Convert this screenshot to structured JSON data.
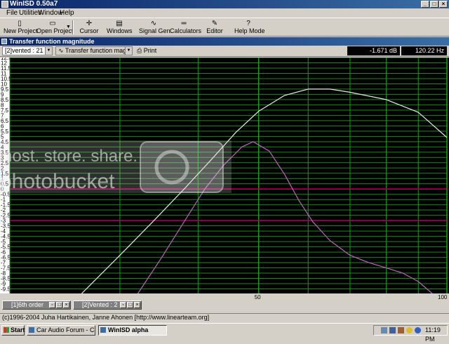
{
  "app": {
    "title": "WinISD 0.50a7",
    "window_buttons": [
      "_",
      "□",
      "×"
    ]
  },
  "menu": [
    "File",
    "Utilities",
    "Window",
    "Help"
  ],
  "toolbar": [
    {
      "label": "New Project",
      "icon": "new-project-icon"
    },
    {
      "label": "Open Project",
      "icon": "open-project-icon"
    },
    {
      "label": "Cursor",
      "icon": "cursor-icon"
    },
    {
      "label": "Windows",
      "icon": "windows-icon"
    },
    {
      "label": "Signal Gen.",
      "icon": "signal-generator-icon"
    },
    {
      "label": "Calculators",
      "icon": "calculators-icon"
    },
    {
      "label": "Editor",
      "icon": "editor-icon"
    },
    {
      "label": "Help Mode",
      "icon": "help-mode-icon"
    }
  ],
  "doc_window": {
    "title": "Transfer function magnitude",
    "project_select": "[2]vented : 21",
    "graph_select": "Transfer function magnitude",
    "print_label": "Print",
    "readout_db": "-1.671 dB",
    "readout_hz": "120.22 Hz"
  },
  "chart_data": {
    "type": "line",
    "title": "",
    "xlabel": "",
    "ylabel": "",
    "x_scale": "log",
    "xlim": [
      20,
      100
    ],
    "ylim": [
      -10,
      12.5
    ],
    "x_tick_labels": [
      "50",
      "100"
    ],
    "y_tick_labels": [
      "12.5",
      "12",
      "11.5",
      "11",
      "10.5",
      "10",
      "9.5",
      "9",
      "8.5",
      "8",
      "7.5",
      "7",
      "6.5",
      "6",
      "5.5",
      "5",
      "4.5",
      "4",
      "3.5",
      "3",
      "2.5",
      "2",
      "1.5",
      "1",
      "0.5",
      "0",
      "-0.5",
      "-1",
      "-1.5",
      "-2",
      "-2.5",
      "-3",
      "-3.5",
      "-4",
      "-4.5",
      "-5",
      "-5.5",
      "-6",
      "-6.5",
      "-7",
      "-7.5",
      "-8",
      "-8.5",
      "-9",
      "-9.5"
    ],
    "grid": true,
    "colors": {
      "background": "#000000",
      "grid_h": "#1e8a1e",
      "grid_v": "#14a014",
      "curve1": "#e8e8e8",
      "curve2": "#c060c0",
      "ref_line": "#b0005a"
    },
    "reference_lines_db": [
      0,
      -3
    ],
    "series": [
      {
        "x": [
          26,
          30,
          34,
          38,
          42,
          46,
          50,
          55,
          60,
          65,
          70,
          80,
          90,
          100
        ],
        "y": [
          -10,
          -6.3,
          -3.0,
          0,
          2.8,
          5.4,
          7.4,
          8.9,
          9.5,
          9.5,
          9.2,
          8.5,
          7.3,
          4.9
        ]
      },
      {
        "x": [
          32,
          35,
          38,
          41,
          44,
          47,
          49,
          52,
          55,
          58,
          61,
          65,
          70,
          75,
          80,
          85,
          90,
          95
        ],
        "y": [
          -10,
          -6.5,
          -3.1,
          0,
          2.3,
          4.0,
          4.5,
          3.6,
          1.4,
          -1.1,
          -3.1,
          -4.9,
          -6.3,
          -7.0,
          -7.5,
          -8.0,
          -8.8,
          -10
        ]
      }
    ]
  },
  "minimized_windows": [
    {
      "label": "[1]6th order"
    },
    {
      "label": "[2]Vented : 2"
    }
  ],
  "status_text": "(c)1996-2004 Juha Hartikainen, Janne Ahonen [http://www.linearteam.org]",
  "taskbar": {
    "start": "Start",
    "tasks": [
      {
        "label": "Car Audio Forum - CarAu..."
      },
      {
        "label": "WinISD alpha"
      }
    ],
    "clock": "11:19 PM"
  },
  "watermark": {
    "line1": "host. store. share.",
    "line2": "photobucket"
  }
}
